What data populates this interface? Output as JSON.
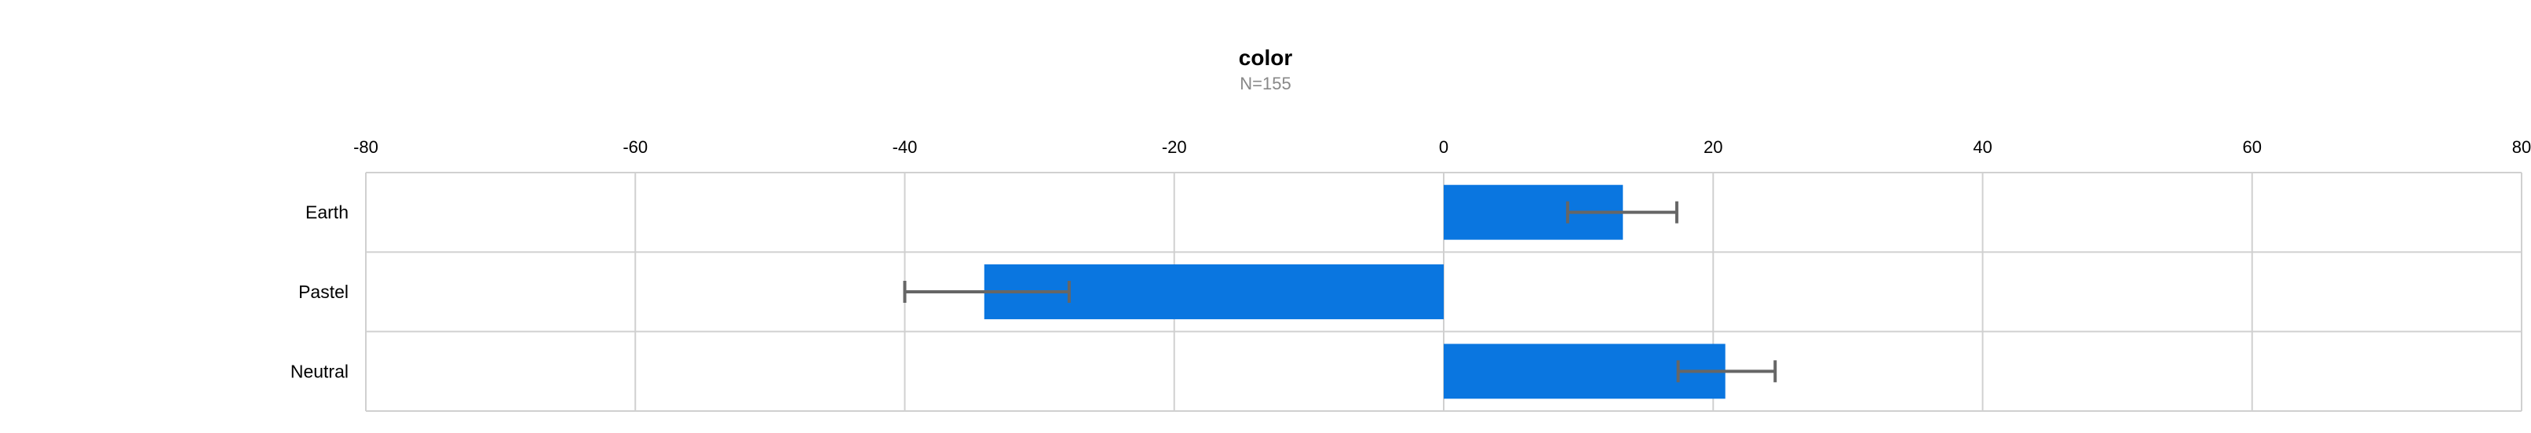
{
  "chart_data": {
    "type": "bar",
    "orientation": "horizontal",
    "title": "color",
    "subtitle": "N=155",
    "categories": [
      "Earth",
      "Pastel",
      "Neutral"
    ],
    "values": [
      13.3,
      -34.1,
      20.9
    ],
    "error_low": [
      9.2,
      -40.0,
      17.4
    ],
    "error_high": [
      17.3,
      -27.8,
      24.6
    ],
    "xlim": [
      -80,
      80
    ],
    "xticks": [
      "-80",
      "-60",
      "-40",
      "-20",
      "0",
      "20",
      "40",
      "60",
      "80"
    ],
    "tick_positions": "top",
    "grid": true,
    "legend": "none",
    "bar_color": "#0a76e0",
    "error_bar_color": "#666666",
    "grid_color": "#d0d0d0"
  }
}
